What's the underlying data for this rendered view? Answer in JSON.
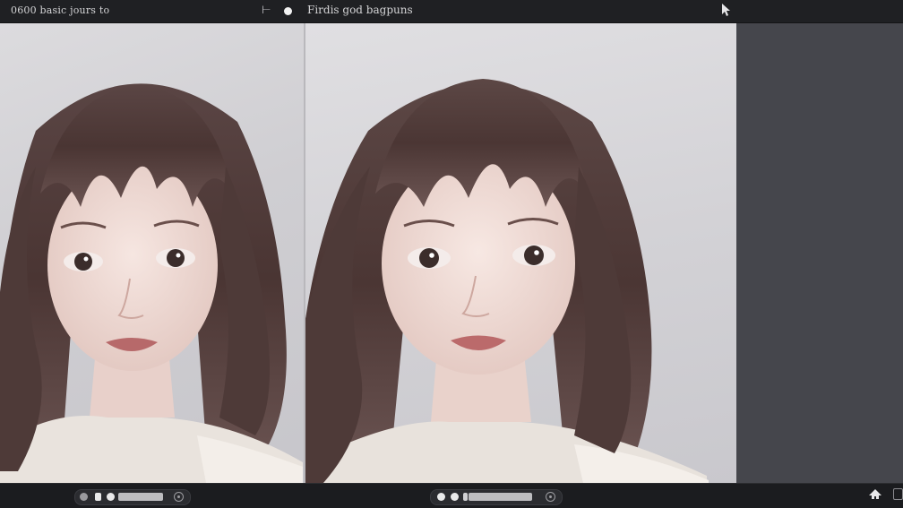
{
  "toolbar": {
    "left_title": "0600 basic jours to",
    "right_title": "Firdis god bagpuns",
    "tool_a_glyph": "⊢",
    "cursor_icon": "cursor-icon"
  },
  "panels": {
    "left": {
      "image_subject": "portrait-photo",
      "icon": "image-icon"
    },
    "right": {
      "image_subject": "portrait-photo",
      "icon": "image-icon"
    },
    "side": {
      "label": ""
    }
  },
  "bottombar": {
    "left_controls": [
      "toggle-icon",
      "stop-icon",
      "play-icon",
      "progress-bar",
      "settings-icon"
    ],
    "right_controls": [
      "play-icon",
      "play-icon",
      "stop-icon",
      "progress-bar",
      "settings-icon"
    ],
    "right_icons": [
      "home-icon",
      "panel-icon"
    ]
  },
  "colors": {
    "toolbar_bg": "#1f2023",
    "canvas_bg": "#d3d2d6",
    "side_panel_bg": "#45464c",
    "bottombar_bg": "#1b1c1f",
    "hair": "#4a3a38",
    "skin": "#efdcd6"
  }
}
